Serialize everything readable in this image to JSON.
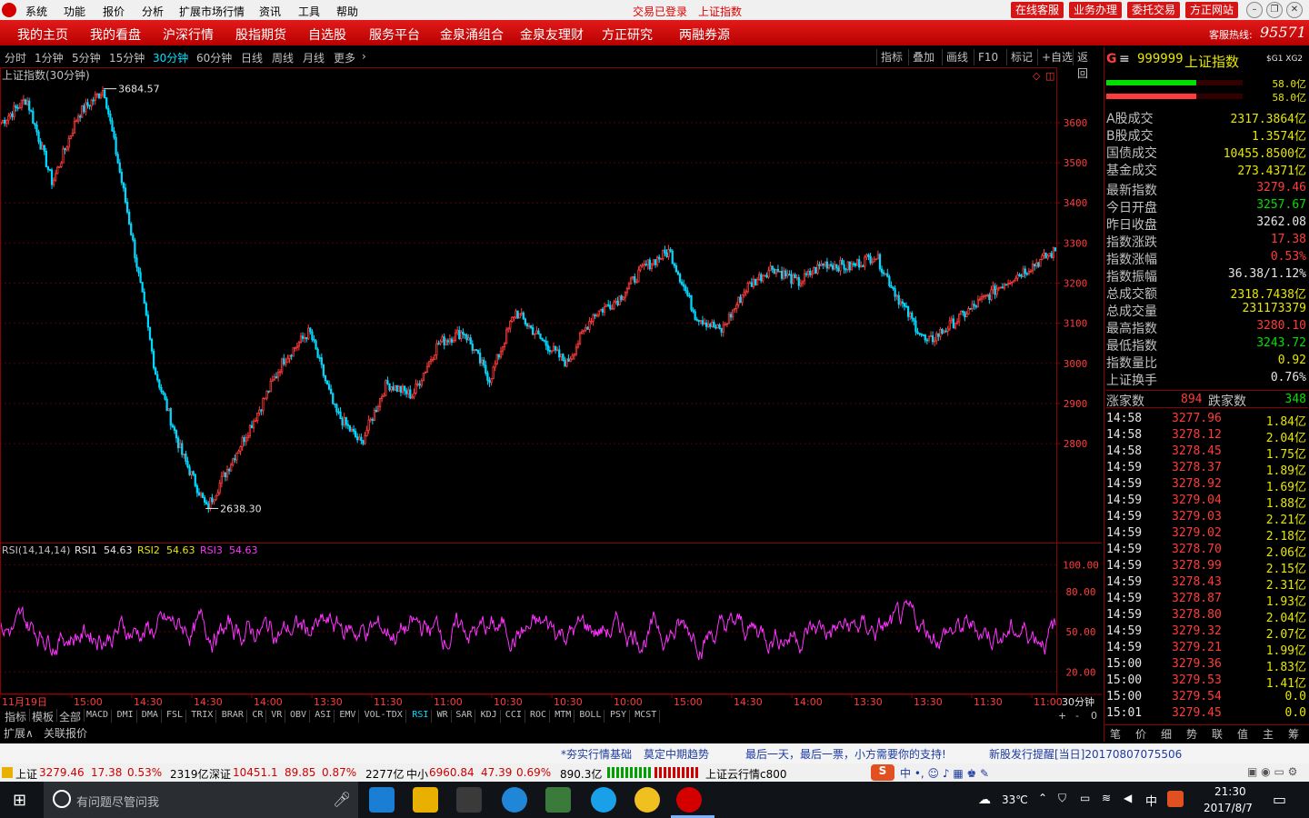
{
  "menubar": {
    "items": [
      "系统",
      "功能",
      "报价",
      "分析",
      "扩展市场行情",
      "资讯",
      "工具",
      "帮助"
    ],
    "login_status": "交易已登录",
    "index_name": "上证指数",
    "buttons": [
      "在线客服",
      "业务办理",
      "委托交易",
      "方正网站"
    ]
  },
  "navbar": {
    "items": [
      "我的主页",
      "我的看盘",
      "沪深行情",
      "股指期货",
      "自选股",
      "服务平台",
      "金泉涌组合",
      "金泉友理财",
      "方正研究",
      "两融券源"
    ],
    "hotline_label": "客服热线:",
    "hotline_number": "95571"
  },
  "periodbar": {
    "periods": [
      "分时",
      "1分钟",
      "5分钟",
      "15分钟",
      "30分钟",
      "60分钟",
      "日线",
      "周线",
      "月线",
      "更多"
    ],
    "active": "30分钟",
    "tools": [
      "指标",
      "叠加",
      "画线",
      "F10",
      "标记",
      "+自选",
      "返回"
    ]
  },
  "chart_data": [
    {
      "type": "candlestick",
      "title": "上证指数(30分钟)",
      "y_ticks": [
        3600,
        3500,
        3400,
        3300,
        3200,
        3100,
        3000,
        2900,
        2800
      ],
      "ylim": [
        2560,
        3720
      ],
      "annotations": [
        {
          "label": "3684.57",
          "value": 3684.57,
          "kind": "high"
        },
        {
          "label": "2638.30",
          "value": 2638.3,
          "kind": "low"
        }
      ],
      "x_labels": [
        "11月19日",
        "15:00",
        "14:30",
        "14:30",
        "14:00",
        "13:30",
        "11:30",
        "11:00",
        "10:30",
        "10:30",
        "10:00",
        "15:00",
        "14:30",
        "14:00",
        "13:30",
        "13:30",
        "11:30",
        "11:00"
      ],
      "series": [
        {
          "name": "close",
          "trend_keypoints": [
            3600,
            3660,
            3450,
            3620,
            3684.57,
            3350,
            2980,
            2780,
            2638.3,
            2760,
            2880,
            3010,
            3080,
            2880,
            2800,
            2950,
            2920,
            3050,
            3080,
            2960,
            3130,
            3060,
            3000,
            3120,
            3160,
            3240,
            3280,
            3120,
            3080,
            3190,
            3240,
            3200,
            3250,
            3240,
            3270,
            3150,
            3050,
            3100,
            3150,
            3200,
            3240,
            3279.46
          ]
        }
      ],
      "colors": {
        "up": "#ff3c3c",
        "down": "#00d8ff"
      }
    },
    {
      "type": "line",
      "title": "RSI(14,14,14)",
      "legend": [
        {
          "name": "RSI1",
          "value": "54.63",
          "color": "#e6e6e6"
        },
        {
          "name": "RSI2",
          "value": "54.63",
          "color": "#e6e600"
        },
        {
          "name": "RSI3",
          "value": "54.63",
          "color": "#ff33ff"
        }
      ],
      "y_ticks": [
        100.0,
        80.0,
        50.0,
        20.0
      ],
      "ylim": [
        10,
        105
      ],
      "series": [
        {
          "name": "RSI3",
          "color": "#ff33ff",
          "range": [
            20,
            82
          ],
          "last": 54.63
        }
      ]
    }
  ],
  "indicators": [
    "指标",
    "模板",
    "全部",
    "MACD",
    "DMI",
    "DMA",
    "FSL",
    "TRIX",
    "BRAR",
    "CR",
    "VR",
    "OBV",
    "ASI",
    "EMV",
    "VOL-TDX",
    "RSI",
    "WR",
    "SAR",
    "KDJ",
    "CCI",
    "ROC",
    "MTM",
    "BOLL",
    "PSY",
    "MCST"
  ],
  "active_indicator": "RSI",
  "expand": {
    "expand_label": "扩展∧",
    "related_label": "关联报价",
    "period_label": "30分钟"
  },
  "right_panel": {
    "code": "999999",
    "name": "上证指数",
    "tags": "$G1 XG2",
    "bar_values": [
      "58.0亿",
      "58.0亿"
    ],
    "bar_fractions": [
      0.66,
      0.66
    ],
    "turnover": [
      {
        "label": "A股成交",
        "value": "2317.3864亿"
      },
      {
        "label": "B股成交",
        "value": "1.3574亿"
      },
      {
        "label": "国债成交",
        "value": "10455.8500亿"
      },
      {
        "label": "基金成交",
        "value": "273.4371亿"
      }
    ],
    "stats": [
      {
        "label": "最新指数",
        "value": "3279.46",
        "color": "red"
      },
      {
        "label": "今日开盘",
        "value": "3257.67",
        "color": "green"
      },
      {
        "label": "昨日收盘",
        "value": "3262.08",
        "color": "white"
      },
      {
        "label": "指数涨跌",
        "value": "17.38",
        "color": "red"
      },
      {
        "label": "指数涨幅",
        "value": "0.53%",
        "color": "red"
      },
      {
        "label": "指数振幅",
        "value": "36.38/1.12%",
        "color": "white"
      },
      {
        "label": "总成交额",
        "value": "2318.7438亿",
        "color": "yellow"
      },
      {
        "label": "总成交量",
        "value": "231173379",
        "color": "yellow"
      },
      {
        "label": "最高指数",
        "value": "3280.10",
        "color": "red"
      },
      {
        "label": "最低指数",
        "value": "3243.72",
        "color": "green"
      },
      {
        "label": "指数量比",
        "value": "0.92",
        "color": "yellow"
      },
      {
        "label": "上证换手",
        "value": "0.76%",
        "color": "white"
      }
    ],
    "up_label": "涨家数",
    "up_count": "894",
    "down_label": "跌家数",
    "down_count": "348",
    "ticks": [
      {
        "time": "14:58",
        "price": "3277.96",
        "amount": "1.84亿"
      },
      {
        "time": "14:58",
        "price": "3278.12",
        "amount": "2.04亿"
      },
      {
        "time": "14:58",
        "price": "3278.45",
        "amount": "1.75亿"
      },
      {
        "time": "14:59",
        "price": "3278.37",
        "amount": "1.89亿"
      },
      {
        "time": "14:59",
        "price": "3278.92",
        "amount": "1.69亿"
      },
      {
        "time": "14:59",
        "price": "3279.04",
        "amount": "1.88亿"
      },
      {
        "time": "14:59",
        "price": "3279.03",
        "amount": "2.21亿"
      },
      {
        "time": "14:59",
        "price": "3279.02",
        "amount": "2.18亿"
      },
      {
        "time": "14:59",
        "price": "3278.70",
        "amount": "2.06亿"
      },
      {
        "time": "14:59",
        "price": "3278.99",
        "amount": "2.15亿"
      },
      {
        "time": "14:59",
        "price": "3278.43",
        "amount": "2.31亿"
      },
      {
        "time": "14:59",
        "price": "3278.87",
        "amount": "1.93亿"
      },
      {
        "time": "14:59",
        "price": "3278.80",
        "amount": "2.04亿"
      },
      {
        "time": "14:59",
        "price": "3279.32",
        "amount": "2.07亿"
      },
      {
        "time": "14:59",
        "price": "3279.21",
        "amount": "1.99亿"
      },
      {
        "time": "15:00",
        "price": "3279.36",
        "amount": "1.83亿"
      },
      {
        "time": "15:00",
        "price": "3279.53",
        "amount": "1.41亿"
      },
      {
        "time": "15:00",
        "price": "3279.54",
        "amount": "0.0"
      },
      {
        "time": "15:01",
        "price": "3279.45",
        "amount": "0.0"
      }
    ],
    "bottom_tabs": [
      "笔",
      "价",
      "细",
      "势",
      "联",
      "值",
      "主",
      "筹"
    ]
  },
  "newsbar": {
    "items": [
      "*夯实行情基础",
      "莫定中期趋势",
      "最后一天，最后一票，小方需要你的支持!",
      "新股发行提醒[当日]20170807075506"
    ]
  },
  "statusbar": {
    "sh": {
      "label": "上证",
      "value": "3279.46",
      "chg": "17.38",
      "pct": "0.53%",
      "amt": "2319亿"
    },
    "sz": {
      "label": "深证",
      "value": "10451.1",
      "chg": "89.85",
      "pct": "0.87%",
      "amt": "2277亿"
    },
    "zx": {
      "label": "中小",
      "value": "6960.84",
      "chg": "47.39",
      "pct": "0.69%",
      "amt": "890.3亿"
    },
    "cloud": "上证云行情c800"
  },
  "taskbar": {
    "search_placeholder": "有问题尽管问我",
    "weather": "33℃",
    "ime": "中",
    "time": "21:30",
    "date": "2017/8/7"
  }
}
